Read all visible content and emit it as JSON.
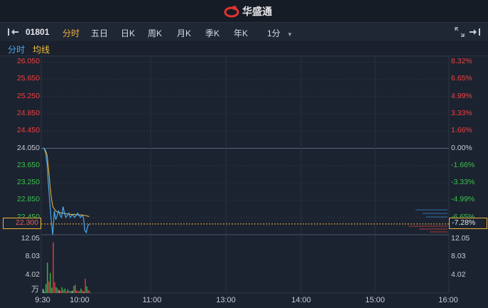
{
  "brand": {
    "name": "华盛通",
    "logo": "huasheng-logo",
    "color": "#e2332f"
  },
  "toolbar": {
    "code": "01801",
    "tabs": [
      "分时",
      "五日",
      "日K",
      "周K",
      "月K",
      "季K",
      "年K"
    ],
    "active_tab": "分时",
    "interval": "1分"
  },
  "subbar": {
    "items": [
      "分时",
      "均线"
    ]
  },
  "colors": {
    "up": "#f04040",
    "down": "#3cc250",
    "flat": "#c8ccd4",
    "price_line": "#4aa8f0",
    "avg_line": "#f0c040",
    "accent": "#f0b23c"
  },
  "chart_data": {
    "type": "line",
    "price_ticks": [
      "26.050",
      "25.650",
      "25.250",
      "24.850",
      "24.450",
      "24.050",
      "23.650",
      "23.250",
      "22.850",
      "22.450"
    ],
    "pct_ticks": [
      "8.32%",
      "6.65%",
      "4.99%",
      "3.33%",
      "1.66%",
      "0.00%",
      "-1.66%",
      "-3.33%",
      "-4.99%",
      "-6.65%"
    ],
    "ylim": [
      22.05,
      26.05
    ],
    "prev_close": 24.05,
    "current_price": "22.300",
    "current_pct": "-7.28%",
    "x_labels": [
      "9:30",
      "10:00",
      "11:00",
      "13:00",
      "14:00",
      "15:00",
      "16:00"
    ],
    "volume_ticks_left": [
      "12.05",
      "8.03",
      "4.02"
    ],
    "volume_ticks_right": [
      "12.05",
      "8.03",
      "4.02"
    ],
    "volume_unit": "万",
    "volume_max": 12.05,
    "price_series": {
      "name": "分时",
      "values": [
        24.05,
        24.05,
        23.95,
        23.7,
        23.2,
        22.75,
        22.35,
        22.05,
        22.6,
        22.4,
        22.5,
        22.6,
        22.5,
        22.45,
        22.7,
        22.55,
        22.45,
        22.5,
        22.55,
        22.45,
        22.5,
        22.5,
        22.45,
        22.5,
        22.55,
        22.5,
        22.45,
        22.5,
        22.45,
        22.15,
        22.1,
        22.25,
        22.3
      ]
    },
    "avg_series": {
      "name": "均线",
      "values": [
        24.05,
        24.05,
        24.0,
        23.9,
        23.6,
        23.2,
        22.9,
        22.7,
        22.65,
        22.6,
        22.58,
        22.57,
        22.56,
        22.55,
        22.55,
        22.54,
        22.54,
        22.53,
        22.53,
        22.52,
        22.52,
        22.52,
        22.52,
        22.51,
        22.51,
        22.51,
        22.51,
        22.51,
        22.5,
        22.5,
        22.49,
        22.48,
        22.47
      ]
    },
    "volume": [
      {
        "v": 0.9,
        "c": "flat"
      },
      {
        "v": 0.4,
        "c": "down"
      },
      {
        "v": 2.0,
        "c": "down"
      },
      {
        "v": 6.8,
        "c": "down"
      },
      {
        "v": 2.6,
        "c": "up"
      },
      {
        "v": 4.5,
        "c": "down"
      },
      {
        "v": 1.2,
        "c": "down"
      },
      {
        "v": 11.3,
        "c": "up"
      },
      {
        "v": 2.4,
        "c": "up"
      },
      {
        "v": 1.3,
        "c": "down"
      },
      {
        "v": 1.0,
        "c": "up"
      },
      {
        "v": 0.6,
        "c": "flat"
      },
      {
        "v": 0.5,
        "c": "up"
      },
      {
        "v": 1.3,
        "c": "down"
      },
      {
        "v": 0.7,
        "c": "up"
      },
      {
        "v": 1.0,
        "c": "down"
      },
      {
        "v": 0.4,
        "c": "up"
      },
      {
        "v": 0.8,
        "c": "down"
      },
      {
        "v": 0.5,
        "c": "up"
      },
      {
        "v": 0.4,
        "c": "down"
      },
      {
        "v": 0.5,
        "c": "flat"
      },
      {
        "v": 1.6,
        "c": "up"
      },
      {
        "v": 1.8,
        "c": "down"
      },
      {
        "v": 0.6,
        "c": "up"
      },
      {
        "v": 0.5,
        "c": "up"
      },
      {
        "v": 0.4,
        "c": "down"
      },
      {
        "v": 1.0,
        "c": "down"
      },
      {
        "v": 0.6,
        "c": "up"
      },
      {
        "v": 0.3,
        "c": "flat"
      },
      {
        "v": 3.2,
        "c": "up"
      },
      {
        "v": 1.5,
        "c": "down"
      },
      {
        "v": 0.7,
        "c": "up"
      },
      {
        "v": 0.4,
        "c": "down"
      }
    ]
  }
}
